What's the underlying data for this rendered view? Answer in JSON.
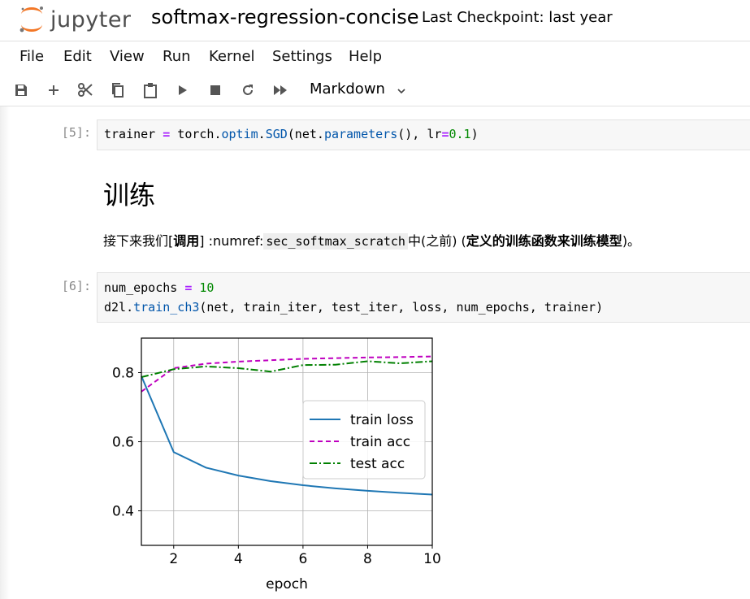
{
  "header": {
    "logo_text": "jupyter",
    "notebook_title": "softmax-regression-concise",
    "checkpoint": "Last Checkpoint: last year"
  },
  "menu": [
    "File",
    "Edit",
    "View",
    "Run",
    "Kernel",
    "Settings",
    "Help"
  ],
  "toolbar": {
    "buttons": [
      "save-icon",
      "add-icon",
      "cut-icon",
      "copy-icon",
      "paste-icon",
      "run-icon",
      "stop-icon",
      "restart-icon",
      "fast-forward-icon"
    ],
    "cell_type": "Markdown"
  },
  "cells": [
    {
      "type": "code",
      "prompt": "[5]:",
      "lines": [
        "trainer = torch.optim.SGD(net.parameters(), lr=0.1)"
      ]
    },
    {
      "type": "markdown",
      "heading": "训练",
      "para": {
        "t1": "接下来我们[",
        "b1": "调用",
        "t2": "] :numref:",
        "code": "sec_softmax_scratch",
        "t3": "中(之前) (",
        "b2": "定义的训练函数来训练模型",
        "t4": ")。"
      }
    },
    {
      "type": "code",
      "prompt": "[6]:",
      "lines": [
        "num_epochs = 10",
        "d2l.train_ch3(net, train_iter, test_iter, loss, num_epochs, trainer)"
      ]
    }
  ],
  "chart_data": {
    "type": "line",
    "xlabel": "epoch",
    "ylabel": "",
    "xlim": [
      1,
      10
    ],
    "ylim": [
      0.3,
      0.9
    ],
    "xticks": [
      2,
      4,
      6,
      8,
      10
    ],
    "yticks": [
      0.4,
      0.6,
      0.8
    ],
    "grid": true,
    "legend_position": "center-right",
    "x": [
      1,
      2,
      3,
      4,
      5,
      6,
      7,
      8,
      9,
      10
    ],
    "series": [
      {
        "name": "train loss",
        "color": "#1f77b4",
        "style": "solid",
        "values": [
          0.79,
          0.57,
          0.525,
          0.502,
          0.486,
          0.474,
          0.465,
          0.458,
          0.452,
          0.447
        ]
      },
      {
        "name": "train acc",
        "color": "#bf00bf",
        "style": "dashed",
        "values": [
          0.745,
          0.813,
          0.826,
          0.832,
          0.836,
          0.84,
          0.842,
          0.844,
          0.845,
          0.847
        ]
      },
      {
        "name": "test acc",
        "color": "#008000",
        "style": "dashdot",
        "values": [
          0.787,
          0.81,
          0.818,
          0.813,
          0.803,
          0.822,
          0.823,
          0.833,
          0.827,
          0.833
        ]
      }
    ]
  }
}
